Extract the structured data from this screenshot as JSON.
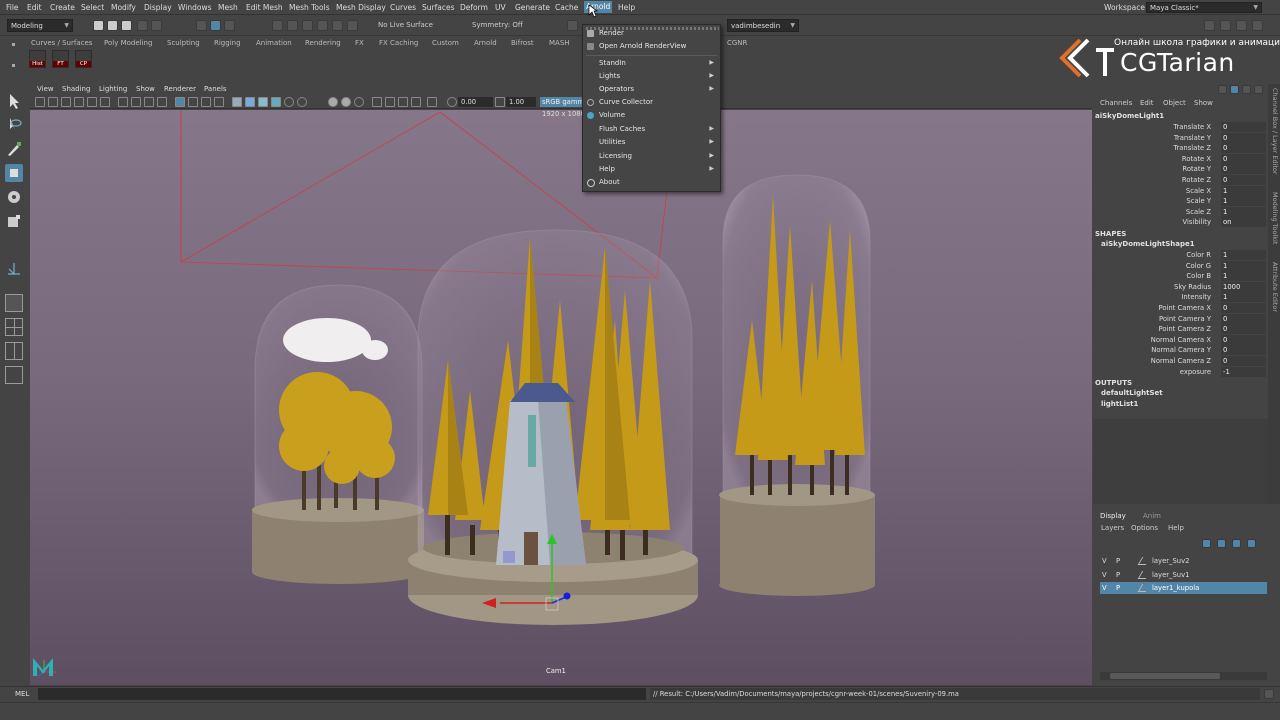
{
  "menubar": {
    "items": [
      "File",
      "Edit",
      "Create",
      "Select",
      "Modify",
      "Display",
      "Windows",
      "Mesh",
      "Edit Mesh",
      "Mesh Tools",
      "Mesh Display",
      "Curves",
      "Surfaces",
      "Deform",
      "UV",
      "Generate",
      "Cache",
      "Arnold",
      "Help"
    ],
    "active": "Arnold",
    "workspace_label": "Workspace :",
    "workspace_value": "Maya Classic*"
  },
  "statusline": {
    "mode": "Modeling",
    "live_surface": "No Live Surface",
    "symmetry": "Symmetry: Off",
    "user": "vadimbesedin"
  },
  "shelf": {
    "tabs": [
      "Curves / Surfaces",
      "Poly Modeling",
      "Sculpting",
      "Rigging",
      "Animation",
      "Rendering",
      "FX",
      "FX Caching",
      "Custom",
      "Arnold",
      "Bifrost",
      "MASH",
      "CGNR"
    ],
    "icons": [
      "Hist",
      "FT",
      "CP"
    ]
  },
  "viewport": {
    "menus": [
      "View",
      "Shading",
      "Lighting",
      "Show",
      "Renderer",
      "Panels"
    ],
    "exposure": "0.00",
    "gamma": "1.00",
    "colorspace": "sRGB gamm",
    "resolution": "1920 x 1080",
    "camera_label": "Cam1"
  },
  "arnold_menu": {
    "items": [
      {
        "label": "Render",
        "sub": false,
        "icon": "render-icon"
      },
      {
        "label": "Open Arnold RenderView",
        "sub": false,
        "icon": "renderview-icon"
      },
      {
        "label": "StandIn",
        "sub": true
      },
      {
        "label": "Lights",
        "sub": true
      },
      {
        "label": "Operators",
        "sub": true
      },
      {
        "label": "Curve Collector",
        "sub": false,
        "icon": "curve-collector-icon"
      },
      {
        "label": "Volume",
        "sub": false,
        "icon": "volume-icon"
      },
      {
        "label": "Flush Caches",
        "sub": true
      },
      {
        "label": "Utilities",
        "sub": true
      },
      {
        "label": "Licensing",
        "sub": true
      },
      {
        "label": "Help",
        "sub": true
      },
      {
        "label": "About",
        "sub": false,
        "icon": "about-icon"
      }
    ]
  },
  "logo": {
    "tagline": "Онлайн школа графики и анимации",
    "name": "CGTarian",
    "accent": "#e0702a"
  },
  "channelbox": {
    "tabs": [
      "Channels",
      "Edit",
      "Object",
      "Show"
    ],
    "node": "aiSkyDomeLight1",
    "attributes": [
      {
        "label": "Translate X",
        "value": "0"
      },
      {
        "label": "Translate Y",
        "value": "0"
      },
      {
        "label": "Translate Z",
        "value": "0"
      },
      {
        "label": "Rotate X",
        "value": "0"
      },
      {
        "label": "Rotate Y",
        "value": "0"
      },
      {
        "label": "Rotate Z",
        "value": "0"
      },
      {
        "label": "Scale X",
        "value": "1"
      },
      {
        "label": "Scale Y",
        "value": "1"
      },
      {
        "label": "Scale Z",
        "value": "1"
      },
      {
        "label": "Visibility",
        "value": "on"
      }
    ],
    "shapes_header": "SHAPES",
    "shape_node": "aiSkyDomeLightShape1",
    "shape_attributes": [
      {
        "label": "Color R",
        "value": "1"
      },
      {
        "label": "Color G",
        "value": "1"
      },
      {
        "label": "Color B",
        "value": "1"
      },
      {
        "label": "Sky Radius",
        "value": "1000"
      },
      {
        "label": "Intensity",
        "value": "1"
      },
      {
        "label": "Point Camera X",
        "value": "0"
      },
      {
        "label": "Point Camera Y",
        "value": "0"
      },
      {
        "label": "Point Camera Z",
        "value": "0"
      },
      {
        "label": "Normal Camera X",
        "value": "0"
      },
      {
        "label": "Normal Camera Y",
        "value": "0"
      },
      {
        "label": "Normal Camera Z",
        "value": "0"
      },
      {
        "label": "exposure",
        "value": "-1"
      }
    ],
    "outputs_header": "OUTPUTS",
    "outputs": [
      "defaultLightSet",
      "lightList1"
    ]
  },
  "side_tabs": [
    "Channel Box / Layer Editor",
    "Modeling Toolkit",
    "Attribute Editor"
  ],
  "layers": {
    "tabs": [
      "Display",
      "Anim"
    ],
    "menus": [
      "Layers",
      "Options",
      "Help"
    ],
    "rows": [
      {
        "v": "V",
        "p": "P",
        "name": "layer_Suv2",
        "selected": false
      },
      {
        "v": "V",
        "p": "P",
        "name": "layer_Suv1",
        "selected": false
      },
      {
        "v": "V",
        "p": "P",
        "name": "layer1_kupola",
        "selected": true
      }
    ]
  },
  "cmdline": {
    "lang": "MEL",
    "result": "// Result: C:/Users/Vadim/Documents/maya/projects/cgnr-week-01/scenes/Suveniry-09.ma"
  }
}
